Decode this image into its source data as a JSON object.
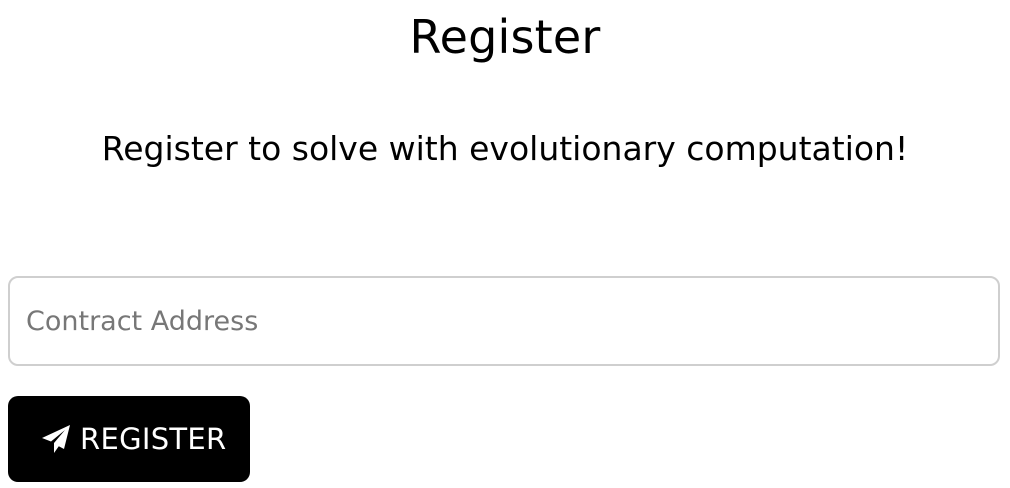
{
  "page": {
    "title": "Register",
    "subtitle": "Register to solve with evolutionary computation!"
  },
  "form": {
    "contract_address": {
      "value": "",
      "placeholder": "Contract Address"
    },
    "submit": {
      "label": "REGISTER",
      "icon": "paper-plane-icon"
    }
  },
  "colors": {
    "button_bg": "#000000",
    "button_text": "#ffffff",
    "input_border": "#cfcfcf",
    "placeholder": "#777777"
  }
}
